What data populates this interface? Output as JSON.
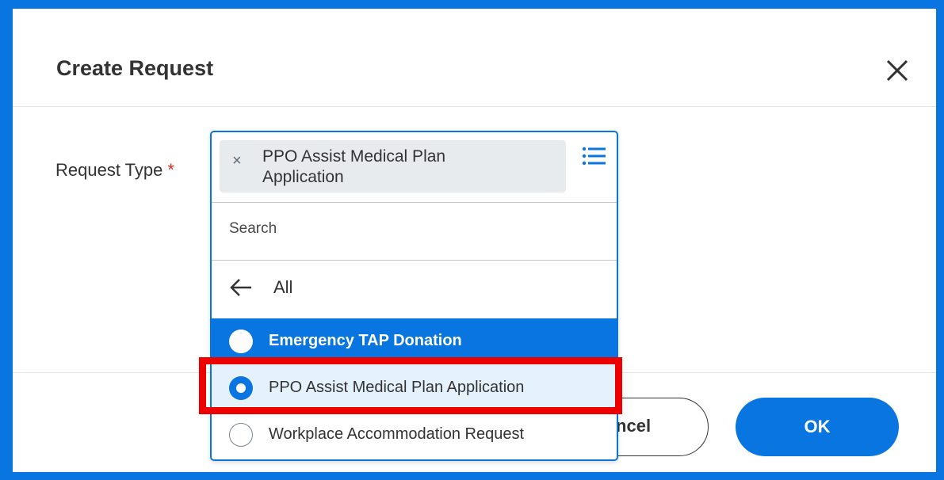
{
  "dialog": {
    "title": "Create Request",
    "close_icon": "close-icon",
    "field_label": "Request Type",
    "required_marker": "*"
  },
  "dropdown": {
    "selected_pill_remove": "×",
    "selected_pill_text": "PPO Assist Medical Plan Application",
    "list_icon": "list-icon",
    "search": {
      "placeholder": "Search",
      "value": ""
    },
    "back_label": "All",
    "back_icon": "arrow-left-icon",
    "options": [
      {
        "label": "Emergency TAP Donation",
        "state": "hovered"
      },
      {
        "label": "PPO Assist Medical Plan Application",
        "state": "selected"
      },
      {
        "label": "Workplace Accommodation Request",
        "state": "unselected"
      }
    ]
  },
  "footer": {
    "cancel_label": "Cancel",
    "ok_label": "OK"
  },
  "colors": {
    "accent": "#0875e1",
    "required": "#de2e21",
    "highlight": "#ec0000",
    "selected_row": "#e5f1fc"
  }
}
